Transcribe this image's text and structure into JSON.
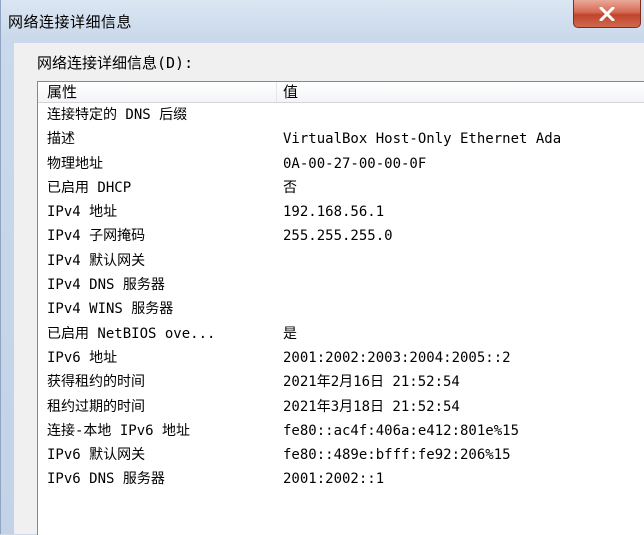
{
  "window": {
    "title": "网络连接详细信息"
  },
  "group": {
    "label": "网络连接详细信息(D):"
  },
  "table": {
    "headers": [
      "属性",
      "值"
    ],
    "rows": [
      [
        "连接特定的 DNS 后缀",
        ""
      ],
      [
        "描述",
        "VirtualBox Host-Only Ethernet Ada"
      ],
      [
        "物理地址",
        "0A-00-27-00-00-0F"
      ],
      [
        "已启用 DHCP",
        "否"
      ],
      [
        "IPv4 地址",
        "192.168.56.1"
      ],
      [
        "IPv4 子网掩码",
        "255.255.255.0"
      ],
      [
        "IPv4 默认网关",
        ""
      ],
      [
        "IPv4 DNS 服务器",
        ""
      ],
      [
        "IPv4 WINS 服务器",
        ""
      ],
      [
        "已启用 NetBIOS ove...",
        "是"
      ],
      [
        "IPv6 地址",
        "2001:2002:2003:2004:2005::2"
      ],
      [
        "获得租约的时间",
        "2021年2月16日 21:52:54"
      ],
      [
        "租约过期的时间",
        "2021年3月18日 21:52:54"
      ],
      [
        "连接-本地 IPv6 地址",
        "fe80::ac4f:406a:e412:801e%15"
      ],
      [
        "IPv6 默认网关",
        "fe80::489e:bfff:fe92:206%15"
      ],
      [
        "IPv6 DNS 服务器",
        "2001:2002::1"
      ]
    ]
  },
  "icons": {
    "close": "close-icon"
  }
}
